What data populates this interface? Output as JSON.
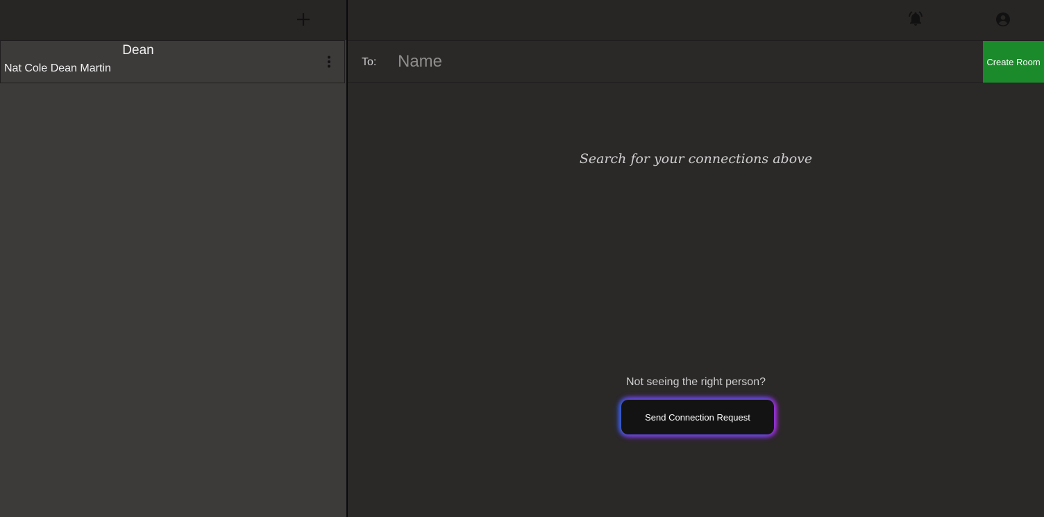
{
  "sidebar": {
    "add_icon": "plus-icon",
    "rooms": [
      {
        "title": "Dean",
        "members": "Nat Cole Dean Martin",
        "menu_icon": "more-vertical-icon"
      }
    ]
  },
  "header": {
    "notifications_icon": "bell-icon",
    "account_icon": "account-circle-icon"
  },
  "compose": {
    "to_label": "To:",
    "name_value": "",
    "name_placeholder": "Name",
    "create_room_label": "Create Room"
  },
  "main": {
    "search_hint": "Search for your connections above",
    "not_seeing_text": "Not seeing the right person?",
    "send_request_label": "Send Connection Request"
  },
  "colors": {
    "create_room_bg": "#1a8a2a",
    "sidebar_bg": "#3d3a3a",
    "main_bg": "#2b2828",
    "header_bg": "#282525"
  }
}
